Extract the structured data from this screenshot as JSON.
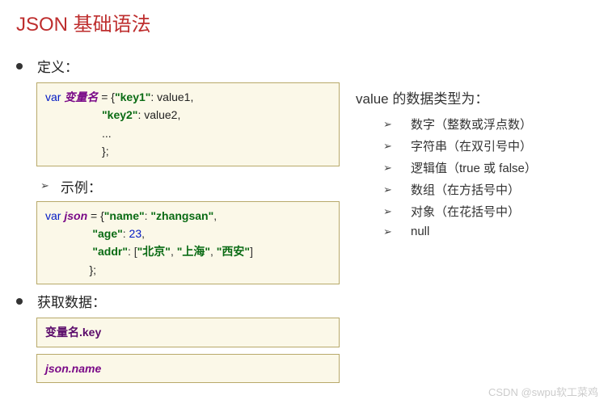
{
  "title": "JSON 基础语法",
  "left": {
    "definition_label": "定义：",
    "code1_var": "var",
    "code1_ident": "变量名",
    "code1_eq": " = {",
    "code1_k1": "\"key1\"",
    "code1_c1": ": value1,",
    "code1_k2": "\"key2\"",
    "code1_c2": ": value2,",
    "code1_dots": "...",
    "code1_end": "};",
    "example_label": "示例：",
    "code2_var": "var",
    "code2_ident": "json",
    "code2_eq": " = {",
    "code2_k1": "\"name\"",
    "code2_c1": ": ",
    "code2_v1": "\"zhangsan\"",
    "code2_comma1": ",",
    "code2_k2": "\"age\"",
    "code2_c2": ": ",
    "code2_v2": "23",
    "code2_comma2": ",",
    "code2_k3": "\"addr\"",
    "code2_c3": ": [",
    "code2_a1": "\"北京\"",
    "code2_ac1": ", ",
    "code2_a2": "\"上海\"",
    "code2_ac2": ", ",
    "code2_a3": "\"西安\"",
    "code2_ae": "]",
    "code2_end": "};",
    "getdata_label": "获取数据：",
    "code3_ident": "变量名",
    "code3_key": ".key",
    "code4_ident": "json.name"
  },
  "right": {
    "title": "value 的数据类型为：",
    "items": [
      "数字（整数或浮点数）",
      "字符串（在双引号中）",
      "逻辑值（true 或 false）",
      "数组（在方括号中）",
      "对象（在花括号中）",
      "null"
    ]
  },
  "watermark": "CSDN @swpu软工菜鸡"
}
